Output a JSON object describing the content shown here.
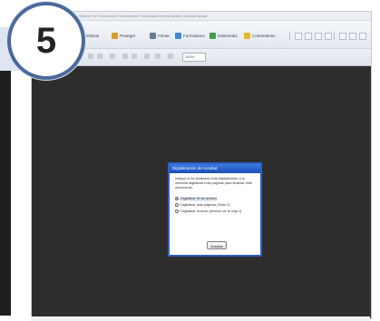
{
  "step_badge": {
    "number": "5"
  },
  "menubar": {
    "text": "Archivo  Edición  Ver  Documento  Comentarios  Formularios  Herramientas  Ventana  Ayuda"
  },
  "toolbar": {
    "items": [
      {
        "label": "Combinar",
        "icon": "combine-icon",
        "color": "#4a7bd0"
      },
      {
        "label": "Proteger",
        "icon": "lock-icon",
        "color": "#d79a2b"
      },
      {
        "label": "Firmar",
        "icon": "pen-icon",
        "color": "#6b7b93"
      },
      {
        "label": "Formularios",
        "icon": "forms-icon",
        "color": "#3c8bd0"
      },
      {
        "label": "Multimedia",
        "icon": "multimedia-icon",
        "color": "#3f9c4a"
      },
      {
        "label": "Comentarios",
        "icon": "comment-icon",
        "color": "#e4b82e"
      }
    ],
    "zoom": "100%"
  },
  "dialog": {
    "title": "Digitalización de Acrobat",
    "message": "Indique si ha finalizado esta digitalización o si necesita digitalizar más páginas para finalizar este documento.",
    "options": [
      {
        "label": "Digitalizar fin de archivo",
        "selected": true
      },
      {
        "label": "Digitalizar más páginas (Scan 2)",
        "selected": false
      },
      {
        "label": "Digitalizar reverso (reverso de la hoja 1)",
        "selected": false
      }
    ],
    "button": "Aceptar"
  }
}
